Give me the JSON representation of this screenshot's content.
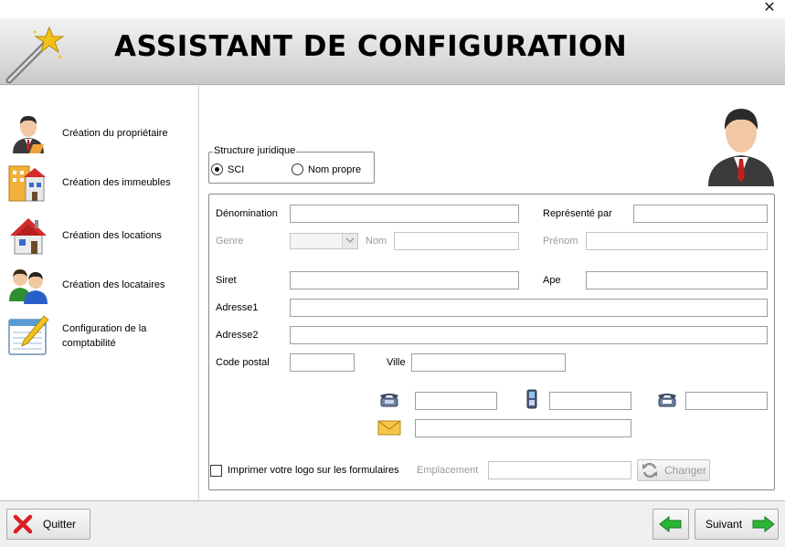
{
  "window": {
    "close_glyph": "✕"
  },
  "header": {
    "title": "ASSISTANT DE CONFIGURATION",
    "icon": "magic-wand-icon"
  },
  "sidebar": {
    "items": [
      {
        "label": "Création du propriétaire",
        "icon": "owner-person-icon"
      },
      {
        "label": "Création des immeubles",
        "icon": "buildings-icon"
      },
      {
        "label": "Création des locations",
        "icon": "house-icon"
      },
      {
        "label": "Création des locataires",
        "icon": "tenants-people-icon"
      },
      {
        "label": "Configuration de la comptabilité",
        "icon": "accounting-notebook-icon"
      }
    ]
  },
  "form": {
    "structure": {
      "legend": "Structure juridique",
      "options": [
        {
          "label": "SCI",
          "selected": true
        },
        {
          "label": "Nom propre",
          "selected": false
        }
      ]
    },
    "labels": {
      "denomination": "Dénomination",
      "represente_par": "Représenté par",
      "genre": "Genre",
      "nom": "Nom",
      "prenom": "Prénom",
      "siret": "Siret",
      "ape": "Ape",
      "adresse1": "Adresse1",
      "adresse2": "Adresse2",
      "code_postal": "Code postal",
      "ville": "Ville"
    },
    "values": {
      "denomination": "",
      "represente_par": "",
      "genre": "",
      "nom": "",
      "prenom": "",
      "siret": "",
      "ape": "",
      "adresse1": "",
      "adresse2": "",
      "code_postal": "",
      "ville": "",
      "telephone": "",
      "mobile": "",
      "fax": "",
      "email": ""
    },
    "contact_icons": [
      "telephone-icon",
      "mobile-phone-icon",
      "fax-icon",
      "email-envelope-icon"
    ],
    "logo": {
      "checkbox_label": "Imprimer votre logo sur les formulaires",
      "checked": false,
      "emplacement_label": "Emplacement",
      "emplacement_value": "",
      "change_button": "Changer"
    }
  },
  "footer": {
    "quit_label": "Quitter",
    "next_label": "Suivant",
    "accent_green": "#2bb534",
    "quit_red": "#d92020"
  }
}
